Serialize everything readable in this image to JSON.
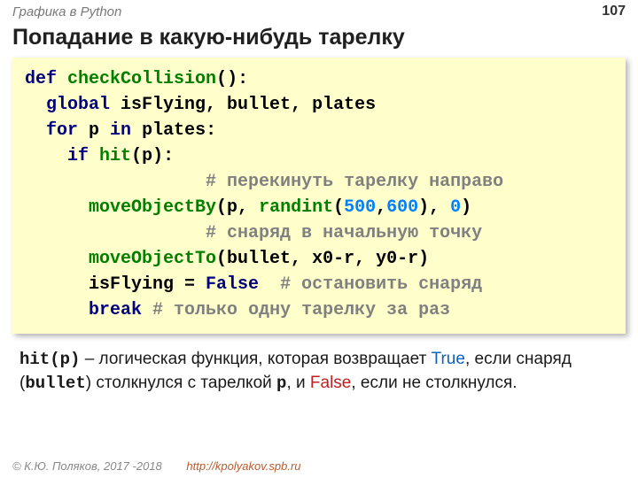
{
  "header": {
    "left": "Графика в Python",
    "page": "107"
  },
  "title": "Попадание в какую-нибудь тарелку",
  "code": {
    "l1": {
      "def": "def",
      "fn": "checkCollision",
      "rest": "():"
    },
    "l2": {
      "kw": "global",
      "rest": " isFlying, bullet, plates"
    },
    "l3": {
      "for": "for",
      "p": " p ",
      "in": "in",
      "rest": " plates:"
    },
    "l4": {
      "if": "if",
      "sp": " ",
      "fn": "hit",
      "rest": "(p):"
    },
    "l5": {
      "pad": "                 ",
      "comment": "# перекинуть тарелку направо"
    },
    "l6": {
      "pad": "      ",
      "fn": "moveObjectBy",
      "a": "(p, ",
      "rand": "randint",
      "b": "(",
      "n1": "500",
      "c": ",",
      "n2": "600",
      "d": "), ",
      "n3": "0",
      "e": ")"
    },
    "l7": {
      "pad": "                 ",
      "comment": "# снаряд в начальную точку"
    },
    "l8": {
      "pad": "      ",
      "fn": "moveObjectTo",
      "rest": "(bullet, x0-r, y0-r)"
    },
    "l9": {
      "pad": "      ",
      "var": "isFlying = ",
      "false": "False",
      "sp": "  ",
      "comment": "# остановить снаряд"
    },
    "l10": {
      "pad": "      ",
      "break": "break",
      "sp": " ",
      "comment": "# только одну тарелку за раз"
    }
  },
  "explain": {
    "hitp": "hit(p)",
    "t1": " – логическая функция, которая возвращает ",
    "true": "True",
    "t2": ", если снаряд (",
    "bullet": "bullet",
    "t3": ") столкнулся с тарелкой ",
    "p": "p",
    "t4": ", и ",
    "false": "False",
    "t5": ", если не столкнулся."
  },
  "footer": {
    "copy": "© К.Ю. Поляков, 2017 -2018",
    "url": "http://kpolyakov.spb.ru"
  }
}
